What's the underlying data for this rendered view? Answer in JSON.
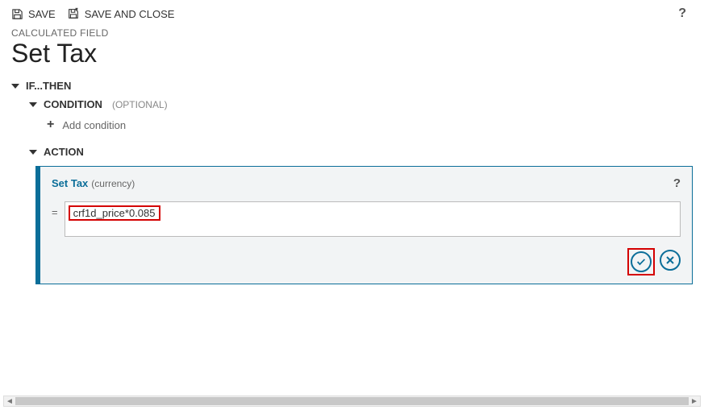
{
  "toolbar": {
    "save": "SAVE",
    "saveClose": "SAVE AND CLOSE",
    "helpGlyph": "?"
  },
  "header": {
    "eyebrow": "CALCULATED FIELD",
    "title": "Set Tax"
  },
  "tree": {
    "ifThen": "IF...THEN",
    "condition": "CONDITION",
    "optional": "(OPTIONAL)",
    "addCondition": "Add condition",
    "action": "ACTION"
  },
  "panel": {
    "title": "Set Tax",
    "subtitle": "(currency)",
    "equals": "=",
    "formula": "crf1d_price*0.085"
  }
}
